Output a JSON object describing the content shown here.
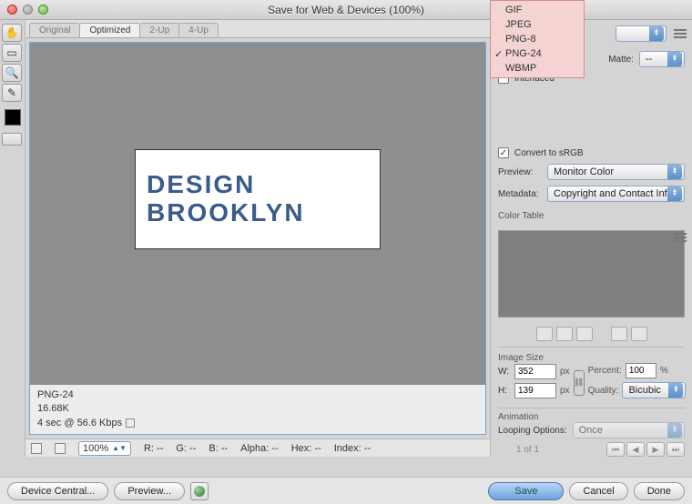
{
  "window": {
    "title": "Save for Web & Devices (100%)"
  },
  "tabs": [
    "Original",
    "Optimized",
    "2-Up",
    "4-Up"
  ],
  "active_tab": "Optimized",
  "preview_text": {
    "line1": "DESIGN",
    "line2": "BROOKLYN"
  },
  "file_info": {
    "format": "PNG-24",
    "size": "16.68K",
    "speed": "4 sec @ 56.6 Kbps"
  },
  "statusbar": {
    "zoom": "100%",
    "r": "R: --",
    "g": "G: --",
    "b": "B: --",
    "alpha": "Alpha: --",
    "hex": "Hex: --",
    "index": "Index: --"
  },
  "format_menu": {
    "options": [
      "GIF",
      "JPEG",
      "PNG-8",
      "PNG-24",
      "WBMP"
    ],
    "selected": "PNG-24"
  },
  "options": {
    "interlaced_label": "Interlaced",
    "interlaced": false,
    "matte_label": "Matte:",
    "matte_value": "--",
    "convert_srgb_label": "Convert to sRGB",
    "convert_srgb": true,
    "preview_label": "Preview:",
    "preview_value": "Monitor Color",
    "metadata_label": "Metadata:",
    "metadata_value": "Copyright and Contact Info"
  },
  "color_table_label": "Color Table",
  "image_size": {
    "title": "Image Size",
    "w_label": "W:",
    "w": "352",
    "h_label": "H:",
    "h": "139",
    "px": "px",
    "percent_label": "Percent:",
    "percent": "100",
    "pct_sign": "%",
    "quality_label": "Quality:",
    "quality_value": "Bicubic"
  },
  "animation": {
    "title": "Animation",
    "looping_label": "Looping Options:",
    "looping_value": "Once",
    "frame_text": "1 of 1"
  },
  "buttons": {
    "device_central": "Device Central...",
    "preview": "Preview...",
    "save": "Save",
    "cancel": "Cancel",
    "done": "Done"
  }
}
